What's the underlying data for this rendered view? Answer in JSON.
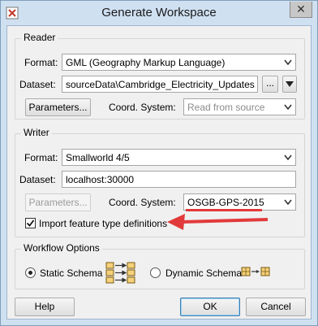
{
  "window": {
    "title": "Generate Workspace",
    "close_glyph": "✕"
  },
  "reader": {
    "legend": "Reader",
    "format_label": "Format:",
    "format_value": "GML (Geography Markup Language)",
    "dataset_label": "Dataset:",
    "dataset_value": "sourceData\\Cambridge_Electricity_Updates.gml\"",
    "browse_label": "...",
    "parameters_label": "Parameters...",
    "coord_label": "Coord. System:",
    "coord_value": "Read from source"
  },
  "writer": {
    "legend": "Writer",
    "format_label": "Format:",
    "format_value": "Smallworld 4/5",
    "dataset_label": "Dataset:",
    "dataset_value": "localhost:30000",
    "parameters_label": "Parameters...",
    "coord_label": "Coord. System:",
    "coord_value": "OSGB-GPS-2015",
    "import_checkbox_label": "Import feature type definitions",
    "import_checked": true
  },
  "workflow": {
    "legend": "Workflow Options",
    "static_label": "Static Schema",
    "dynamic_label": "Dynamic Schema",
    "selected": "static"
  },
  "buttons": {
    "help": "Help",
    "ok": "OK",
    "cancel": "Cancel"
  },
  "colors": {
    "annotation": "#e23a3a",
    "frame": "#cfe0f1"
  },
  "icons": [
    "app-icon",
    "close-icon",
    "dropdown-arrow-icon",
    "static-schema-icon",
    "dynamic-schema-icon",
    "annotation-arrow-icon"
  ]
}
